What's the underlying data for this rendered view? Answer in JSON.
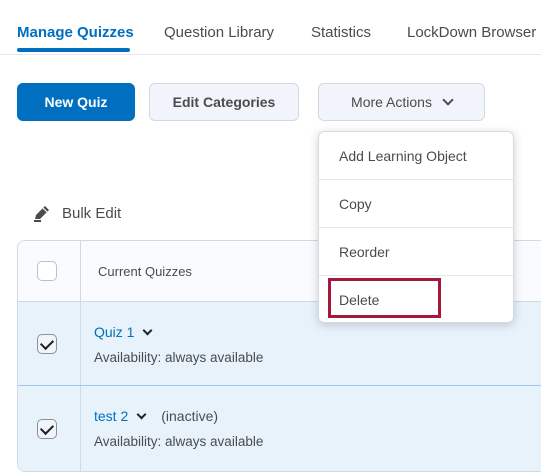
{
  "tabs": [
    {
      "label": "Manage Quizzes"
    },
    {
      "label": "Question Library"
    },
    {
      "label": "Statistics"
    },
    {
      "label": "LockDown Browser"
    }
  ],
  "toolbar": {
    "new_quiz": "New Quiz",
    "edit_categories": "Edit Categories",
    "more_actions": "More Actions"
  },
  "menu": {
    "items": [
      {
        "label": "Add Learning Object"
      },
      {
        "label": "Copy"
      },
      {
        "label": "Reorder"
      },
      {
        "label": "Delete"
      }
    ],
    "highlighted": "Delete",
    "highlight_color": "#a5183b"
  },
  "bulk_edit": {
    "label": "Bulk Edit"
  },
  "table": {
    "header": "Current Quizzes",
    "rows": [
      {
        "title": "Quiz 1",
        "status": "",
        "availability": "Availability: always available",
        "checked": true
      },
      {
        "title": "test 2",
        "status": "(inactive)",
        "availability": "Availability: always available",
        "checked": true
      }
    ]
  },
  "colors": {
    "accent": "#006fbf",
    "text": "#494c4e",
    "selected_row": "#e8f2fb"
  }
}
